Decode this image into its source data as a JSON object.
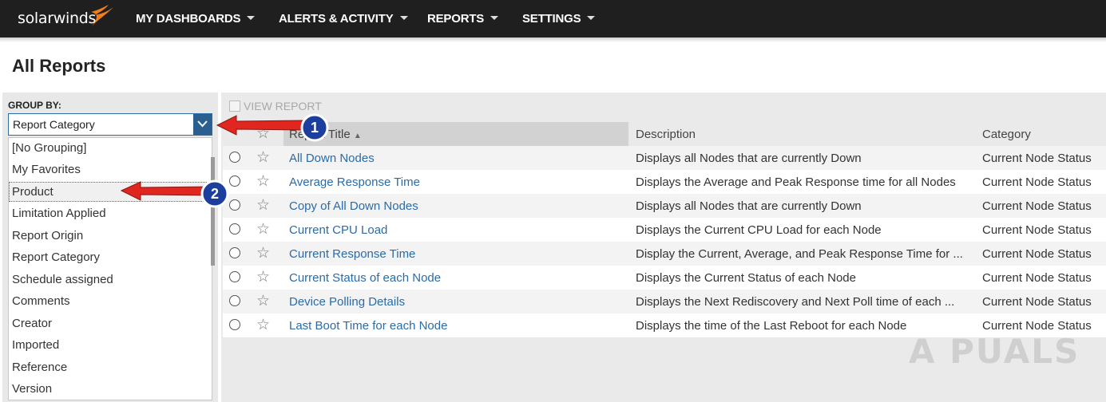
{
  "brand": {
    "logo_text": "solarwinds"
  },
  "nav": {
    "items": [
      {
        "label": "MY DASHBOARDS"
      },
      {
        "label": "ALERTS & ACTIVITY"
      },
      {
        "label": "REPORTS"
      },
      {
        "label": "SETTINGS"
      }
    ]
  },
  "page": {
    "title": "All Reports"
  },
  "group_by": {
    "label": "GROUP BY:",
    "selected": "Report Category",
    "options": [
      "[No Grouping]",
      "My Favorites",
      "Product",
      "Limitation Applied",
      "Report Origin",
      "Report Category",
      "Schedule assigned",
      "Comments",
      "Creator",
      "Imported",
      "Reference",
      "Version"
    ]
  },
  "toolbar": {
    "view_report_label": "VIEW REPORT"
  },
  "table": {
    "columns": {
      "title": "Report Title",
      "description": "Description",
      "category": "Category"
    },
    "rows": [
      {
        "title": "All Down Nodes",
        "description": "Displays all Nodes that are currently Down",
        "category": "Current Node Status"
      },
      {
        "title": "Average Response Time",
        "description": "Displays the Average and Peak Response time for all Nodes",
        "category": "Current Node Status"
      },
      {
        "title": "Copy of All Down Nodes",
        "description": "Displays all Nodes that are currently Down",
        "category": "Current Node Status"
      },
      {
        "title": "Current CPU Load",
        "description": "Displays the Current CPU Load for each Node",
        "category": "Current Node Status"
      },
      {
        "title": "Current Response Time",
        "description": "Display the Current, Average, and Peak Response Time for ...",
        "category": "Current Node Status"
      },
      {
        "title": "Current Status of each Node",
        "description": "Displays the Current Status of each Node",
        "category": "Current Node Status"
      },
      {
        "title": "Device Polling Details",
        "description": "Displays the Next Rediscovery and Next Poll time of each ...",
        "category": "Current Node Status"
      },
      {
        "title": "Last Boot Time for each Node",
        "description": "Displays the time of the Last Reboot for each Node",
        "category": "Current Node Status"
      }
    ]
  },
  "annotations": {
    "step1": "1",
    "step2": "2"
  },
  "watermark": {
    "text": "A PUALS"
  },
  "colors": {
    "topbar": "#1f1f1f",
    "link": "#2a6ca8",
    "select_button": "#2a5f8f",
    "arrow": "#e0261f",
    "badge": "#1c3f9e"
  }
}
